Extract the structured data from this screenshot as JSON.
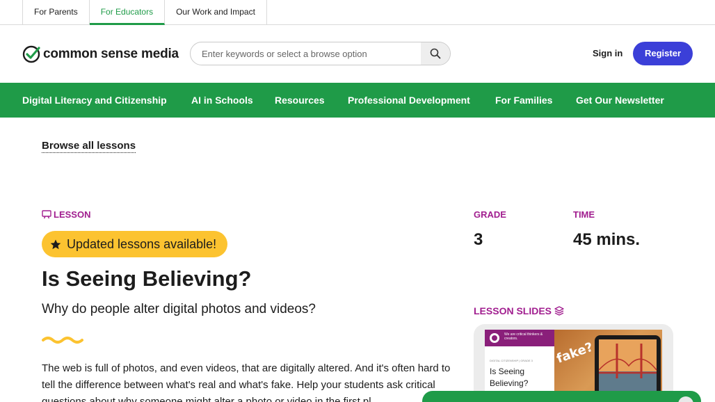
{
  "top_tabs": [
    {
      "label": "For Parents",
      "active": false
    },
    {
      "label": "For Educators",
      "active": true
    },
    {
      "label": "Our Work and Impact",
      "active": false
    }
  ],
  "header": {
    "logo_text": "common sense media",
    "logo_icon": "checkmark-icon",
    "search_placeholder": "Enter keywords or select a browse option",
    "search_icon": "search-icon",
    "signin_label": "Sign in",
    "register_label": "Register"
  },
  "nav": {
    "items": [
      {
        "label": "Digital Literacy and Citizenship"
      },
      {
        "label": "AI in Schools"
      },
      {
        "label": "Resources"
      },
      {
        "label": "Professional Development"
      },
      {
        "label": "For Families"
      },
      {
        "label": "Get Our Newsletter"
      }
    ]
  },
  "browse_link": "Browse all lessons",
  "lesson": {
    "tag_label": "LESSON",
    "tag_icon": "presentation-icon",
    "updated_label": "Updated lessons available!",
    "updated_icon": "star-icon",
    "title": "Is Seeing Believing?",
    "subtitle": "Why do people alter digital photos and videos?",
    "description": "The web is full of photos, and even videos, that are digitally altered. And it's often hard to tell the difference between what's real and what's fake. Help your students ask critical questions about why someone might alter a photo or video in the first pl"
  },
  "meta": {
    "grade_label": "GRADE",
    "grade_value": "3",
    "time_label": "TIME",
    "time_value": "45 mins."
  },
  "slides": {
    "label": "LESSON SLIDES",
    "icon": "layers-icon",
    "thumb_header": "We are critical thinkers & creators.",
    "thumb_tag": "DIGITAL CITIZENSHIP | GRADE 3",
    "thumb_title": "Is Seeing Believing?",
    "thumb_photo_text": "fake?"
  },
  "colors": {
    "brand_green": "#1f9b48",
    "accent_purple": "#a11e8f",
    "register_blue": "#3b3fd8",
    "highlight_yellow": "#fcc330"
  }
}
